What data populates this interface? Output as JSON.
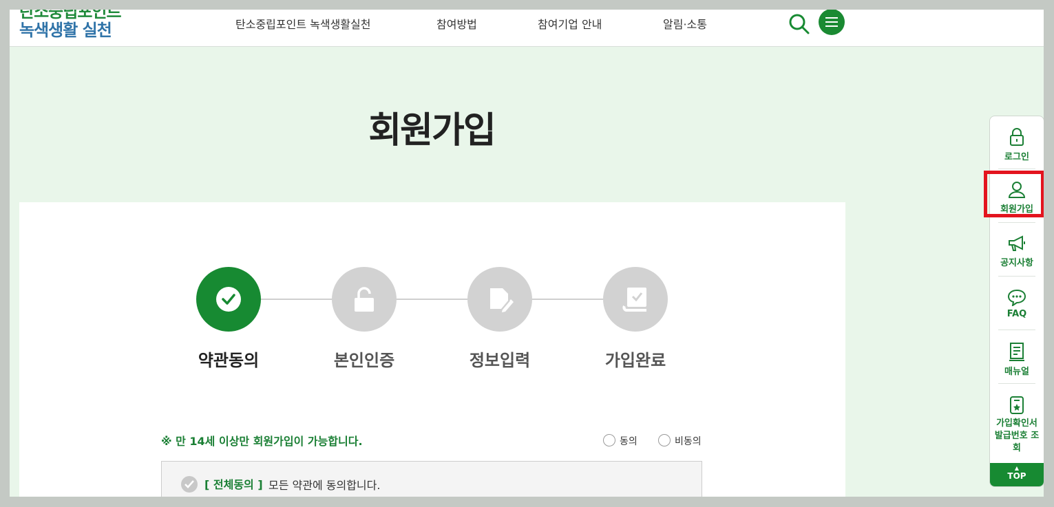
{
  "header": {
    "logo_line1": "탄소중립포인트",
    "logo_line2": "녹색생활 실천",
    "nav": [
      "탄소중립포인트 녹색생활실천",
      "참여방법",
      "참여기업 안내",
      "알림·소통"
    ],
    "search_icon": "search-icon",
    "menu_icon": "hamburger-menu-icon"
  },
  "main": {
    "title": "회원가입",
    "steps": [
      {
        "label": "약관동의",
        "icon": "check-icon",
        "active": true
      },
      {
        "label": "본인인증",
        "icon": "unlock-icon",
        "active": false
      },
      {
        "label": "정보입력",
        "icon": "edit-document-icon",
        "active": false
      },
      {
        "label": "가입완료",
        "icon": "book-check-icon",
        "active": false
      }
    ],
    "age_notice": "※ 만 14세 이상만 회원가입이 가능합니다.",
    "agree_option": "동의",
    "disagree_option": "비동의",
    "all_agree_bracket": "[ 전체동의 ]",
    "all_agree_text": "모든 약관에 동의합니다."
  },
  "quick_menu": {
    "items": [
      {
        "label": "로그인",
        "icon": "lock-icon"
      },
      {
        "label": "회원가입",
        "icon": "user-icon"
      },
      {
        "label": "공지사항",
        "icon": "megaphone-icon"
      },
      {
        "label": "FAQ",
        "icon": "chat-bubble-icon"
      },
      {
        "label": "매뉴얼",
        "icon": "document-icon"
      },
      {
        "label": "가입확인서 발급번호 조회",
        "icon": "certificate-icon"
      }
    ],
    "top_label": "TOP"
  },
  "colors": {
    "brand_green": "#178a32",
    "logo_blue": "#2f73a8",
    "highlight_red": "#e3141e",
    "page_bg": "#e9f6ea"
  }
}
